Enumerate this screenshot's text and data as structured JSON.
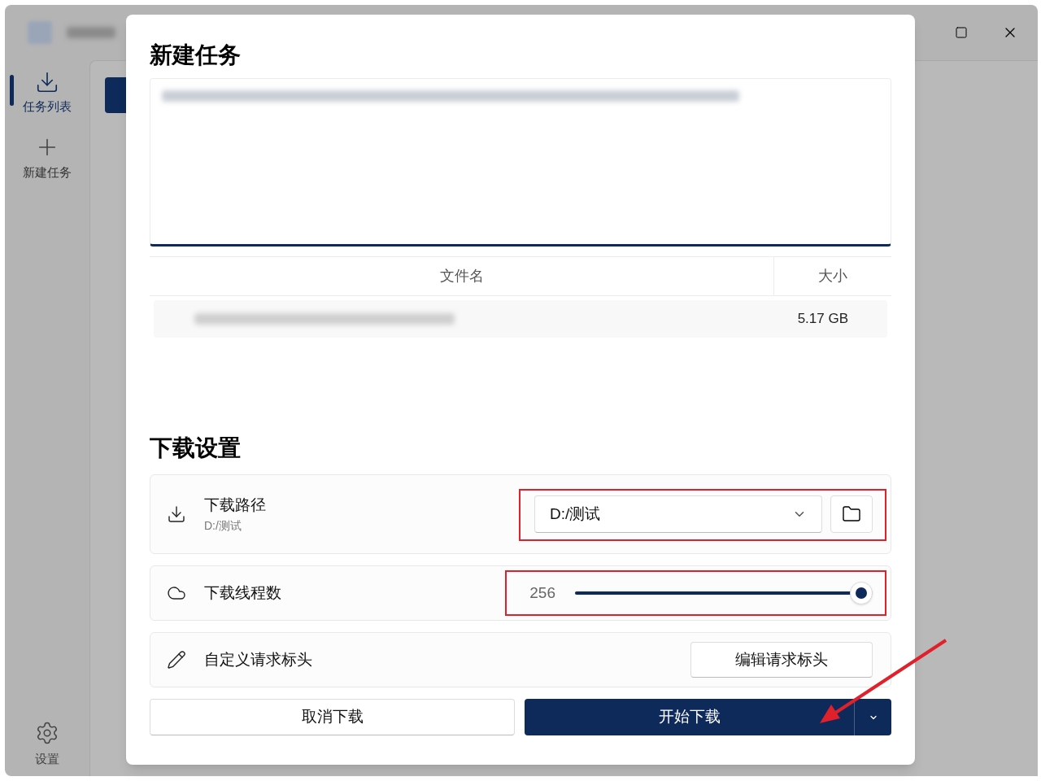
{
  "sidebar": {
    "items": [
      {
        "label": "任务列表",
        "selected": true,
        "kind": "download"
      },
      {
        "label": "新建任务",
        "selected": false,
        "kind": "add"
      }
    ],
    "settings": {
      "label": "设置"
    }
  },
  "dialog": {
    "title": "新建任务",
    "table": {
      "columns": [
        "文件名",
        "大小"
      ],
      "rows": [
        {
          "size": "5.17 GB"
        }
      ]
    },
    "section_title": "下载设置",
    "path": {
      "label": "下载路径",
      "sub": "D:/测试",
      "value": "D:/测试"
    },
    "threads": {
      "label": "下载线程数",
      "reading": "256",
      "level": 1
    },
    "headers": {
      "label": "自定义请求标头",
      "button": "编辑请求标头"
    },
    "buttons": {
      "cancel": "取消下载",
      "start": "开始下载"
    }
  }
}
